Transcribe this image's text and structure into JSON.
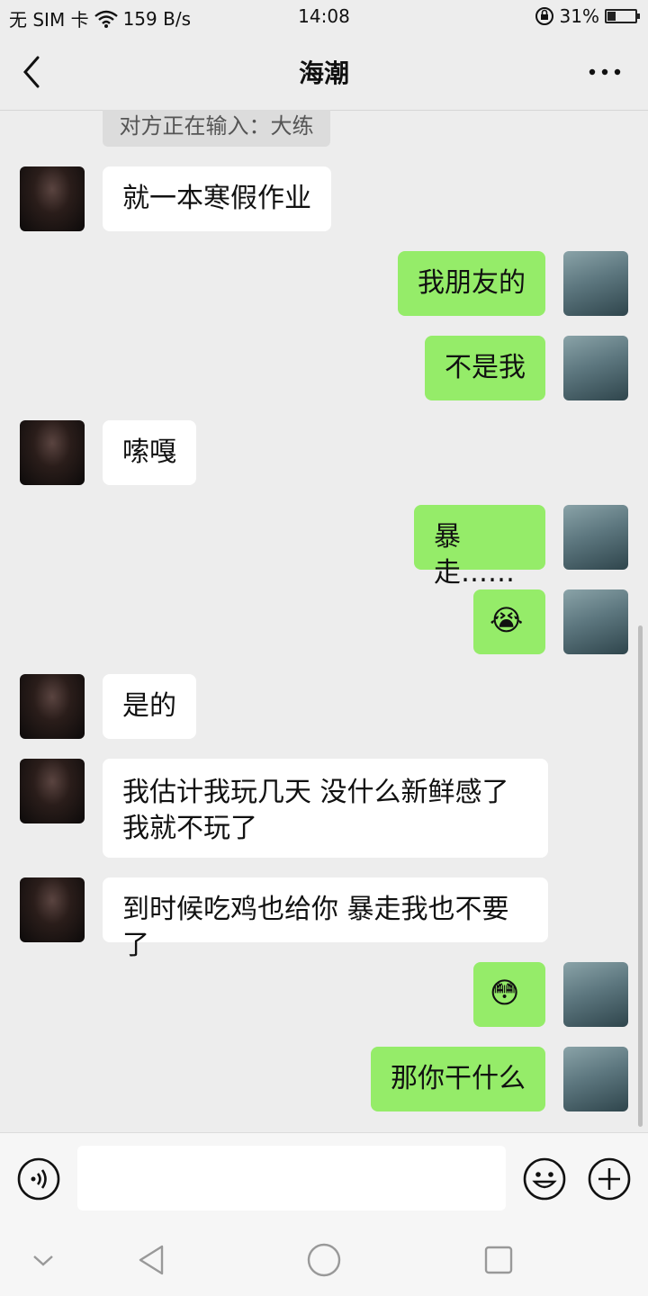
{
  "status_bar": {
    "carrier": "无 SIM 卡",
    "net_speed": "159 B/s",
    "time": "14:08",
    "battery_percent": "31%",
    "battery_level": 0.31
  },
  "header": {
    "title": "海潮"
  },
  "typing_indicator": "对方正在输入：大练",
  "messages": [
    {
      "from": "them",
      "text": "就一本寒假作业"
    },
    {
      "from": "me",
      "text": "我朋友的"
    },
    {
      "from": "me",
      "text": "不是我"
    },
    {
      "from": "them",
      "text": "嗦嘎"
    },
    {
      "from": "me",
      "text": "暴走……"
    },
    {
      "from": "me",
      "text": "😭"
    },
    {
      "from": "them",
      "text": "是的"
    },
    {
      "from": "them",
      "text": "我估计我玩几天 没什么新鲜感了我就不玩了"
    },
    {
      "from": "them",
      "text": "到时候吃鸡也给你 暴走我也不要了"
    },
    {
      "from": "me",
      "text": "😳"
    },
    {
      "from": "me",
      "text": "那你干什么"
    }
  ],
  "input": {
    "value": "",
    "placeholder": ""
  },
  "colors": {
    "outgoing_bubble": "#95ec69",
    "incoming_bubble": "#ffffff",
    "background": "#ededed"
  },
  "icons": [
    "wifi-icon",
    "lock-rotation-icon",
    "battery-icon",
    "back-arrow-icon",
    "more-icon",
    "voice-icon",
    "emoji-icon",
    "plus-icon",
    "nav-down-icon",
    "nav-back-icon",
    "nav-home-icon",
    "nav-recent-icon"
  ]
}
